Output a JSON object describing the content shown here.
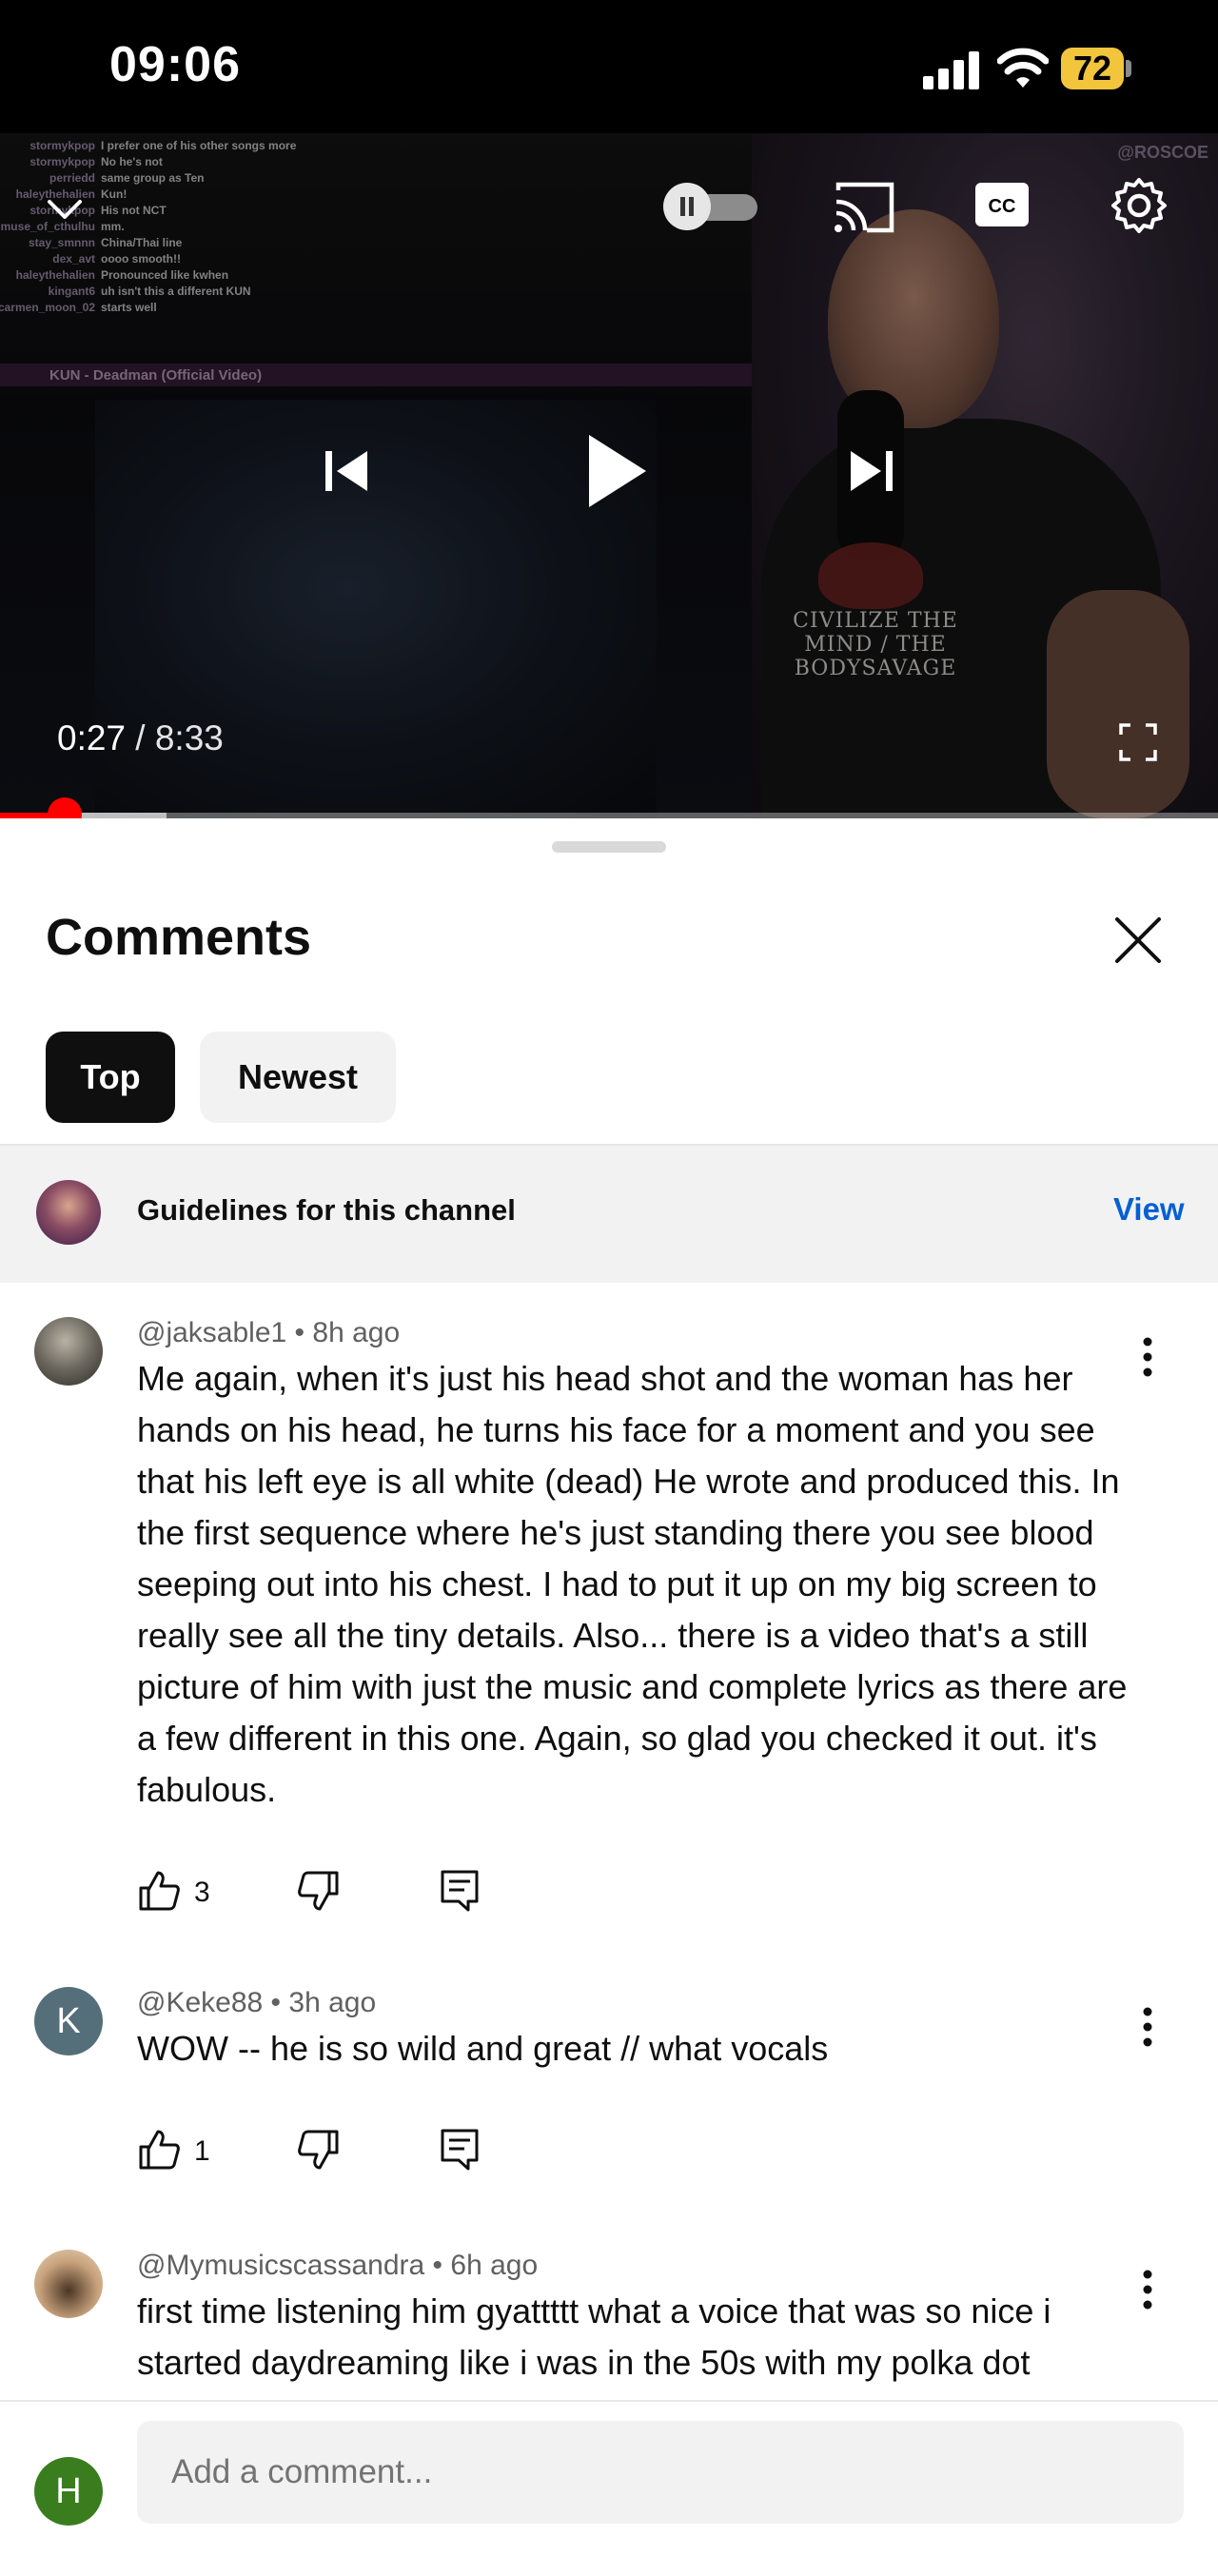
{
  "status_bar": {
    "time": "09:06",
    "battery": "72"
  },
  "player": {
    "current_time": "0:27",
    "separator": " / ",
    "duration": "8:33",
    "progress_fraction": 0.053,
    "overlay_chat": [
      {
        "user": "stormykpop",
        "msg": "I prefer one of his other songs more"
      },
      {
        "user": "stormykpop",
        "msg": "No he's not"
      },
      {
        "user": "perriedd",
        "msg": "same group as Ten"
      },
      {
        "user": "haleythehalien",
        "msg": "Kun!"
      },
      {
        "user": "stormykpop",
        "msg": "His not NCT"
      },
      {
        "user": "muse_of_cthulhu",
        "msg": "mm."
      },
      {
        "user": "stay_smnnn",
        "msg": "China/Thai line"
      },
      {
        "user": "dex_avt",
        "msg": "oooo smooth!!"
      },
      {
        "user": "haleythehalien",
        "msg": "Pronounced like kwhen"
      },
      {
        "user": "kingant6",
        "msg": "uh isn't this a different KUN"
      },
      {
        "user": "carmen_moon_02",
        "msg": "starts well"
      }
    ],
    "overlay_title": "KUN - Deadman (Official Video)",
    "watermark": "@ROSCOE",
    "shirt_text": "CIVILIZE THE MIND / THE BODYSAVAGE",
    "icons": [
      "chevron-down-icon",
      "autoplay-pause-toggle",
      "cast-icon",
      "cc-icon",
      "settings-gear-icon",
      "previous-icon",
      "play-icon",
      "next-icon",
      "fullscreen-icon"
    ]
  },
  "comments_panel": {
    "title": "Comments",
    "filters": [
      "Top",
      "Newest"
    ],
    "guidelines": {
      "text": "Guidelines for this channel",
      "action": "View"
    },
    "comments": [
      {
        "author": "@jaksable1",
        "time": "8h ago",
        "text": "Me again, when it's just his head shot and the woman has her hands on his head, he turns his face for a moment and you see that his left eye is all white (dead) He wrote and produced this. In the first sequence where he's just standing there you see blood seeping out into his chest. I had to put it up on my big screen to really see all the tiny details. Also... there is a video that's a still picture of him with just the music and complete lyrics as there are a few different in this one. Again, so glad you checked it out. it's fabulous.",
        "likes": "3"
      },
      {
        "author": "@Keke88",
        "time": "3h ago",
        "avatar_letter": "K",
        "text": "WOW -- he is so wild and great // what vocals",
        "likes": "1"
      },
      {
        "author": "@Mymusicscassandra",
        "time": "6h ago",
        "text": "first time listening him gyattttt what a voice that was so nice i started daydreaming like i was in the 50s with my polka dot"
      }
    ],
    "meta_separator": " • "
  },
  "composer": {
    "avatar_letter": "H",
    "placeholder": "Add a comment..."
  },
  "colors": {
    "accent_red": "#ff0000",
    "link_blue": "#065fd4",
    "battery": "#f2c53d",
    "user_avatar": "#3a7d1f"
  }
}
